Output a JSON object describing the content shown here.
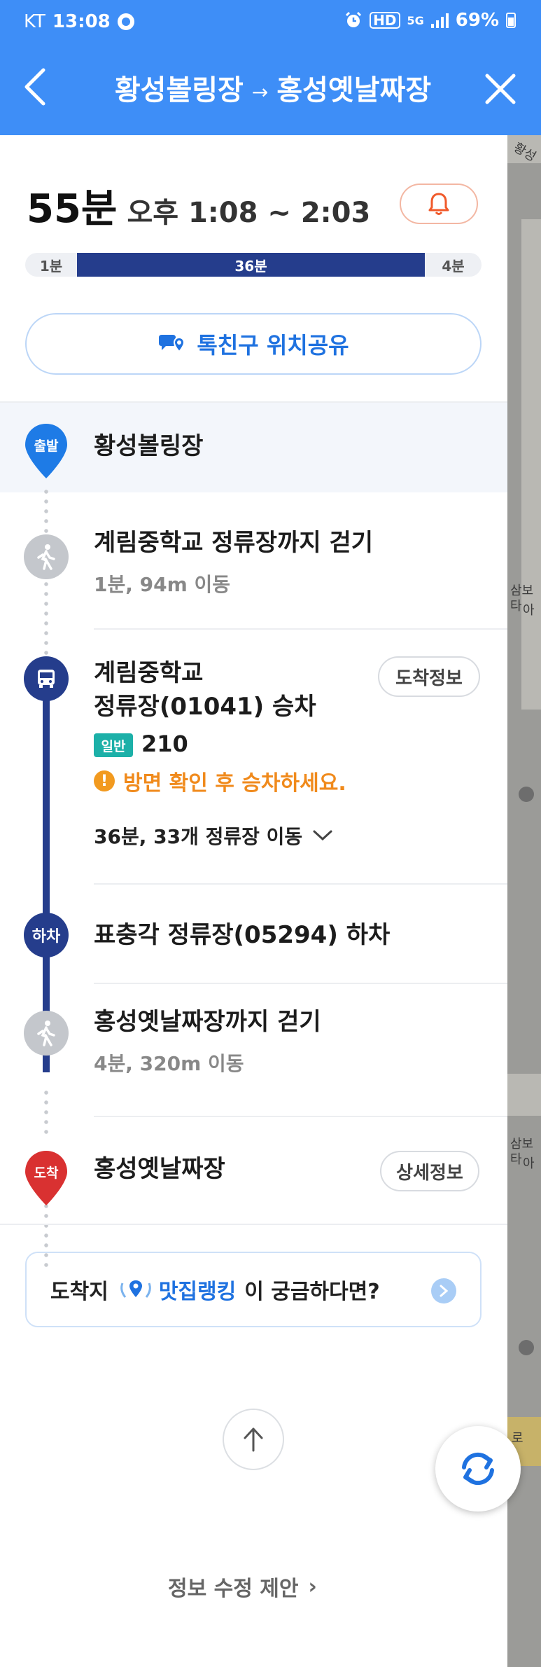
{
  "status_bar": {
    "carrier": "KT",
    "time": "13:08",
    "hd_label": "HD",
    "network": "5G",
    "battery": "69%"
  },
  "header": {
    "origin": "황성볼링장",
    "arrow": "→",
    "destination": "홍성옛날짜장"
  },
  "summary": {
    "total_time": "55분",
    "time_range": "오후 1:08 ~ 2:03"
  },
  "segments": [
    {
      "label": "1분",
      "minutes": 1,
      "mode": "walk"
    },
    {
      "label": "36분",
      "minutes": 36,
      "mode": "bus"
    },
    {
      "label": "4분",
      "minutes": 4,
      "mode": "walk"
    }
  ],
  "share": {
    "label": "톡친구 위치공유"
  },
  "route": {
    "start": {
      "pin_label": "출발",
      "name": "황성볼링장"
    },
    "walk1": {
      "title": "계림중학교 정류장까지 걷기",
      "detail": "1분, 94m 이동"
    },
    "board": {
      "title_line1": "계림중학교",
      "title_line2": "정류장(01041) 승차",
      "arrival_info_label": "도착정보",
      "bus_type": "일반",
      "bus_number": "210",
      "warning": "방면 확인 후 승차하세요.",
      "warning_icon": "!",
      "stops_summary": "36분, 33개 정류장 이동"
    },
    "alight": {
      "circle_label": "하차",
      "title": "표충각 정류장(05294) 하차"
    },
    "walk2": {
      "title": "홍성옛날짜장까지 걷기",
      "detail": "4분, 320m 이동"
    },
    "end": {
      "pin_label": "도착",
      "name": "홍성옛날짜장",
      "detail_label": "상세정보"
    }
  },
  "promo": {
    "prefix": "도착지",
    "brand": "맛집랭킹",
    "suffix": "이 궁금하다면?"
  },
  "footer": {
    "suggest_label": "정보 수정 제안",
    "suggest_chevron": "›"
  },
  "map": {
    "labels": [
      "황성",
      "삼보타",
      "아",
      "삼보타",
      "아",
      "로"
    ]
  },
  "colors": {
    "header_blue": "#3e8ef7",
    "bus_navy": "#253d8c",
    "start_blue": "#1e7be6",
    "end_red": "#d93131",
    "warning_orange": "#f08a1c",
    "general_bus_teal": "#1cb0a8"
  }
}
